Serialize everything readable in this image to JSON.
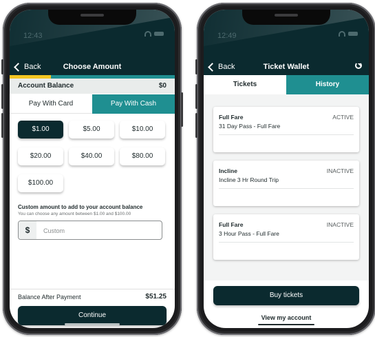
{
  "left_phone": {
    "status_time": "12:43",
    "nav": {
      "back_label": "Back",
      "title": "Choose Amount"
    },
    "progress_fraction": 0.25,
    "account_balance": {
      "label": "Account Balance",
      "value": "$0"
    },
    "pay_tabs": {
      "card": "Pay With Card",
      "cash": "Pay With Cash"
    },
    "amounts": [
      "$1.00",
      "$5.00",
      "$10.00",
      "$20.00",
      "$40.00",
      "$80.00",
      "$100.00"
    ],
    "selected_amount": "$1.00",
    "custom": {
      "title": "Custom amount to add to your account balance",
      "subtitle": "You can choose any amount between $1.00 and $100.00",
      "currency_symbol": "$",
      "placeholder": "Custom"
    },
    "balance_after": {
      "label": "Balance After Payment",
      "value": "$51.25"
    },
    "continue_label": "Continue"
  },
  "right_phone": {
    "status_time": "12:49",
    "nav": {
      "back_label": "Back",
      "title": "Ticket Wallet"
    },
    "tabs": {
      "tickets": "Tickets",
      "history": "History"
    },
    "tickets": [
      {
        "name": "Full Fare",
        "description": "31 Day Pass - Full Fare",
        "status": "ACTIVE"
      },
      {
        "name": "Incline",
        "description": "Incline 3 Hr Round Trip",
        "status": "INACTIVE"
      },
      {
        "name": "Full Fare",
        "description": "3 Hour Pass - Full Fare",
        "status": "INACTIVE"
      }
    ],
    "buy_label": "Buy tickets",
    "account_link": "View my account"
  },
  "colors": {
    "dark_teal": "#0b2a2f",
    "teal": "#1f8f91",
    "yellow": "#f3c623"
  }
}
